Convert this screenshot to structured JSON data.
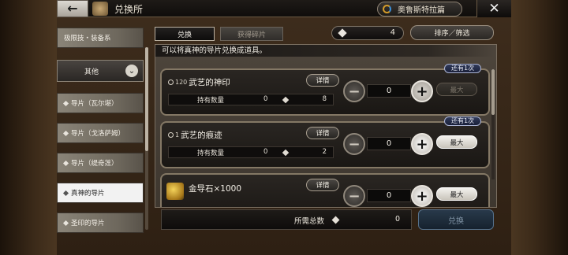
{
  "header": {
    "title": "兑换所",
    "world_button": "奥鲁斯特拉篇"
  },
  "sidebar": {
    "top_item": "极限技・装备系",
    "sub_label": "其他",
    "items": [
      {
        "label": "导片（瓦尔堪）",
        "selected": false
      },
      {
        "label": "导片（戈洛萨姆）",
        "selected": false
      },
      {
        "label": "导片（缇奇莲）",
        "selected": false
      },
      {
        "label": "真神的导片",
        "selected": true
      },
      {
        "label": "圣印的导片",
        "selected": false
      }
    ]
  },
  "tabs": [
    {
      "label": "兑换",
      "active": true
    },
    {
      "label": "获得碎片",
      "active": false
    }
  ],
  "currency": {
    "value": "4",
    "icon": "shard-gem-icon"
  },
  "sort_button": "排序／筛选",
  "notice": "可以将真神的导片兑换成道具。",
  "items": [
    {
      "name": "武艺的神印",
      "level_prefix": "120",
      "detail": "详情",
      "owned_label": "持有数量",
      "owned": "0",
      "cost": "8",
      "qty": "0",
      "remaining": "还有1次",
      "max_label": "最大",
      "max_enabled": false,
      "plus_enabled": false
    },
    {
      "name": "武艺的痕迹",
      "level_prefix": "1",
      "detail": "详情",
      "owned_label": "持有数量",
      "owned": "0",
      "cost": "2",
      "qty": "0",
      "remaining": "还有1次",
      "max_label": "最大",
      "max_enabled": true,
      "plus_enabled": true
    },
    {
      "name": "金导石×1000",
      "detail": "详情",
      "qty": "0",
      "max_label": "最大",
      "max_enabled": true,
      "plus_enabled": true
    }
  ],
  "footer": {
    "total_label": "所需总数",
    "total_value": "0",
    "exchange_label": "兑换"
  },
  "colors": {
    "accent_badge": "#1a203a",
    "exchange_disabled": "#16222e"
  }
}
